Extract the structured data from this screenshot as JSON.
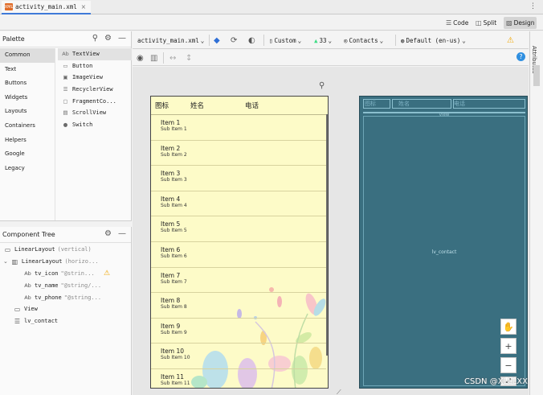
{
  "file_tab": {
    "icon_label": "XML",
    "name": "activity_main.xml",
    "close": "×"
  },
  "more_icon": "⋮",
  "view_modes": {
    "code": "Code",
    "split": "Split",
    "design": "Design"
  },
  "palette": {
    "title": "Palette",
    "categories": [
      "Common",
      "Text",
      "Buttons",
      "Widgets",
      "Layouts",
      "Containers",
      "Helpers",
      "Google",
      "Legacy"
    ],
    "widgets": [
      {
        "icon": "Ab",
        "label": "TextView"
      },
      {
        "icon": "▭",
        "label": "Button"
      },
      {
        "icon": "▣",
        "label": "ImageView"
      },
      {
        "icon": "☰",
        "label": "RecyclerView"
      },
      {
        "icon": "▢",
        "label": "FragmentCo..."
      },
      {
        "icon": "▤",
        "label": "ScrollView"
      },
      {
        "icon": "●",
        "label": "Switch"
      }
    ]
  },
  "tree": {
    "title": "Component Tree",
    "items": [
      {
        "icon": "▭",
        "label": "LinearLayout",
        "sub": "(vertical)"
      },
      {
        "icon": "▥",
        "label": "LinearLayout",
        "sub": "(horizo..."
      },
      {
        "icon": "Ab",
        "label": "tv_icon",
        "sub": "\"@strin..."
      },
      {
        "icon": "Ab",
        "label": "tv_name",
        "sub": "\"@string/..."
      },
      {
        "icon": "Ab",
        "label": "tv_phone",
        "sub": "\"@string..."
      },
      {
        "icon": "▭",
        "label": "View",
        "sub": ""
      },
      {
        "icon": "☰",
        "label": "lv_contact",
        "sub": ""
      }
    ]
  },
  "design_toolbar": {
    "file": "activity_main.xml",
    "device": "Custom",
    "api": "33",
    "theme": "Contacts",
    "locale": "Default (en-us)"
  },
  "phone": {
    "header": {
      "icon": "图标",
      "name": "姓名",
      "phone": "电话"
    },
    "items": [
      {
        "title": "Item 1",
        "sub": "Sub Item 1"
      },
      {
        "title": "Item 2",
        "sub": "Sub Item 2"
      },
      {
        "title": "Item 3",
        "sub": "Sub Item 3"
      },
      {
        "title": "Item 4",
        "sub": "Sub Item 4"
      },
      {
        "title": "Item 5",
        "sub": "Sub Item 5"
      },
      {
        "title": "Item 6",
        "sub": "Sub Item 6"
      },
      {
        "title": "Item 7",
        "sub": "Sub Item 7"
      },
      {
        "title": "Item 8",
        "sub": "Sub Item 8"
      },
      {
        "title": "Item 9",
        "sub": "Sub Item 9"
      },
      {
        "title": "Item 10",
        "sub": "Sub Item 10"
      },
      {
        "title": "Item 11",
        "sub": "Sub Item 11"
      }
    ]
  },
  "blueprint": {
    "icon": "图标",
    "name": "姓名",
    "phone": "电话",
    "view_label": "view",
    "list_label": "lv_contact"
  },
  "attributes_label": "Attributes",
  "watermark": "CSDN @XLLLXX",
  "colors": {
    "accent": "#3f7ad8",
    "phone_bg": "#fdfbc8",
    "blueprint_bg": "#3a6f80",
    "warning": "#f0a500"
  }
}
